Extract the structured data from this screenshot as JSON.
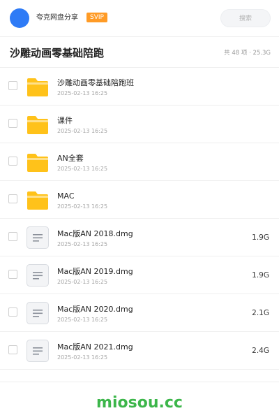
{
  "header": {
    "app_name": "夸克网盘分享",
    "badge": "SVIP",
    "search_placeholder": "搜索"
  },
  "folder": {
    "title": "沙雕动画零基础陪跑",
    "count": "共 48 项",
    "separator": "·",
    "total_size": "25.3G"
  },
  "items": [
    {
      "type": "folder",
      "name": "沙雕动画零基础陪跑班",
      "date": "2025-02-13 16:25",
      "size": ""
    },
    {
      "type": "folder",
      "name": "课件",
      "date": "2025-02-13 16:25",
      "size": ""
    },
    {
      "type": "folder",
      "name": "AN全套",
      "date": "2025-02-13 16:25",
      "size": ""
    },
    {
      "type": "folder",
      "name": "MAC",
      "date": "2025-02-13 16:25",
      "size": ""
    },
    {
      "type": "file",
      "name": "Mac版AN 2018.dmg",
      "date": "2025-02-13 16:25",
      "size": "1.9G"
    },
    {
      "type": "file",
      "name": "Mac版AN 2019.dmg",
      "date": "2025-02-13 16:25",
      "size": "1.9G"
    },
    {
      "type": "file",
      "name": "Mac版AN 2020.dmg",
      "date": "2025-02-13 16:25",
      "size": "2.1G"
    },
    {
      "type": "file",
      "name": "Mac版AN 2021.dmg",
      "date": "2025-02-13 16:25",
      "size": "2.4G"
    }
  ],
  "watermark": "miosou.cc",
  "colors": {
    "avatar": "#2e7bf6",
    "badge": "#ff9b26",
    "folder": "#ffc21a",
    "watermark": "#3cb64a"
  },
  "icons": {
    "folder": "folder-icon",
    "file": "document-icon"
  }
}
